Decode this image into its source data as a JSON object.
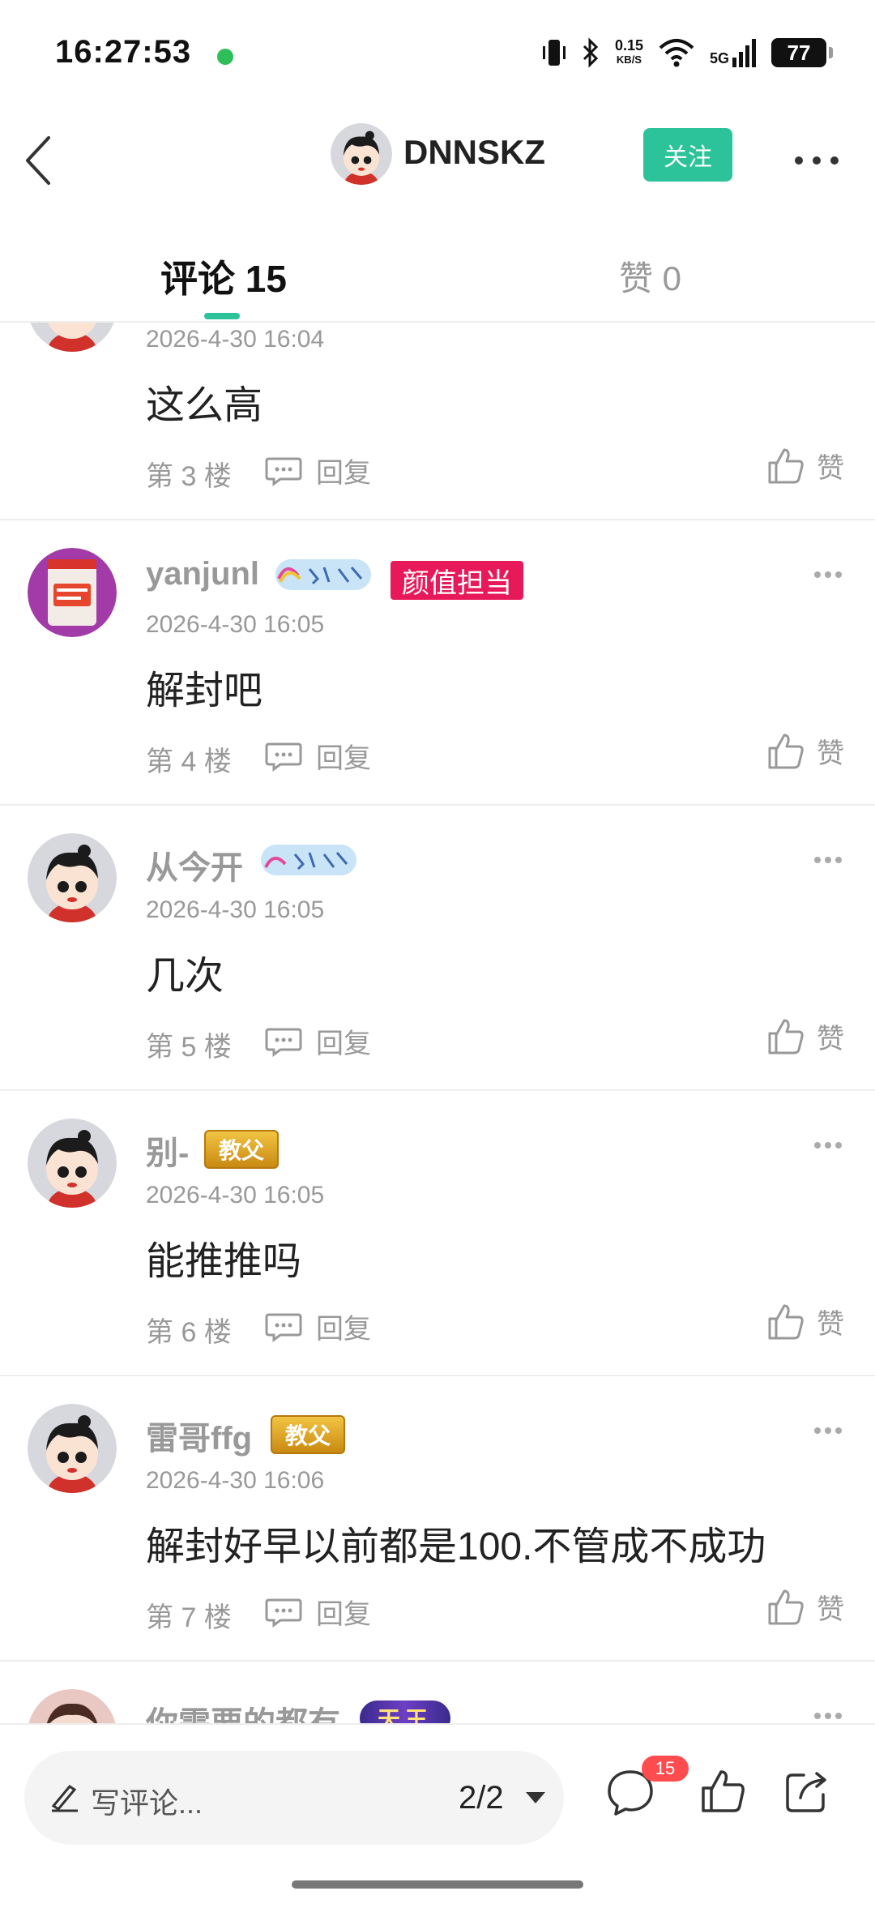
{
  "status_bar": {
    "time": "16:27:53",
    "net_speed_value": "0.15",
    "net_speed_unit": "KB/S",
    "network": "5G",
    "battery": "77"
  },
  "header": {
    "username": "DNNSKZ",
    "follow_label": "关注"
  },
  "tabs": {
    "comments_label": "评论 15",
    "likes_label": "赞 0"
  },
  "comments": [
    {
      "username": "",
      "time": "2026-4-30 16:04",
      "text": "这么高",
      "floor": "第 3 楼",
      "reply_label": "回复",
      "like_label": "赞"
    },
    {
      "username": "yanjunl",
      "badges": [
        "颜值担当"
      ],
      "time": "2026-4-30 16:05",
      "text": "解封吧",
      "floor": "第 4 楼",
      "reply_label": "回复",
      "like_label": "赞"
    },
    {
      "username": "从今开",
      "time": "2026-4-30 16:05",
      "text": "几次",
      "floor": "第 5 楼",
      "reply_label": "回复",
      "like_label": "赞"
    },
    {
      "username": "别-",
      "badges": [
        "教父"
      ],
      "time": "2026-4-30 16:05",
      "text": "能推推吗",
      "floor": "第 6 楼",
      "reply_label": "回复",
      "like_label": "赞"
    },
    {
      "username": "雷哥ffg",
      "badges": [
        "教父"
      ],
      "time": "2026-4-30 16:06",
      "text": "解封好早以前都是100.不管成不成功",
      "floor": "第 7 楼",
      "reply_label": "回复",
      "like_label": "赞"
    },
    {
      "username": "你需要的都有",
      "badges": [
        "天王"
      ],
      "time": "",
      "text": ""
    }
  ],
  "bottom_bar": {
    "input_placeholder": "写评论...",
    "page_indicator": "2/2",
    "comment_count_badge": "15"
  },
  "colors": {
    "accent": "#2cc39a",
    "badge_pink": "#e8195a",
    "badge_gold": "#d9a21f",
    "badge_purple": "#5b2da8",
    "text_muted": "#999999"
  }
}
